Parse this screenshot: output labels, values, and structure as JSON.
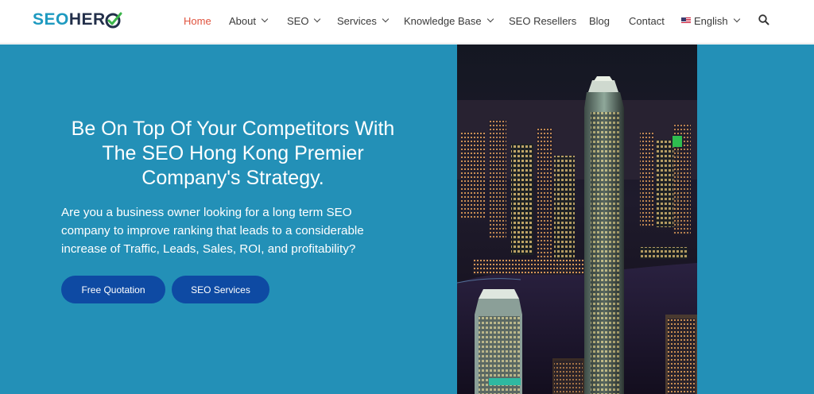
{
  "logo": {
    "part1": "SEO",
    "part2": "HER"
  },
  "nav": {
    "items": [
      {
        "label": "Home",
        "has_dropdown": false,
        "active": true
      },
      {
        "label": "About",
        "has_dropdown": true
      },
      {
        "label": "SEO",
        "has_dropdown": true
      },
      {
        "label": "Services",
        "has_dropdown": true
      },
      {
        "label": "Knowledge Base",
        "has_dropdown": true
      },
      {
        "label": "SEO Resellers",
        "has_dropdown": false
      },
      {
        "label": "Blog",
        "has_dropdown": false
      },
      {
        "label": "Contact",
        "has_dropdown": false
      }
    ],
    "language": "English",
    "search_icon": "search-icon"
  },
  "hero": {
    "title": "Be On Top Of Your Competitors With The SEO Hong Kong Premier Company's Strategy.",
    "text": "Are you a business owner looking for a long term SEO company to improve ranking that leads to a considerable increase of Traffic, Leads, Sales, ROI, and profitability?",
    "buttons": [
      "Free Quotation",
      "SEO Services"
    ],
    "image": "Hong Kong skyline at night"
  },
  "colors": {
    "hero_bg": "#2390b7",
    "button": "#0e4aa3",
    "active_nav": "#e0533e",
    "logo_accent": "#1e9ac0",
    "logo_dark": "#222f4a"
  }
}
